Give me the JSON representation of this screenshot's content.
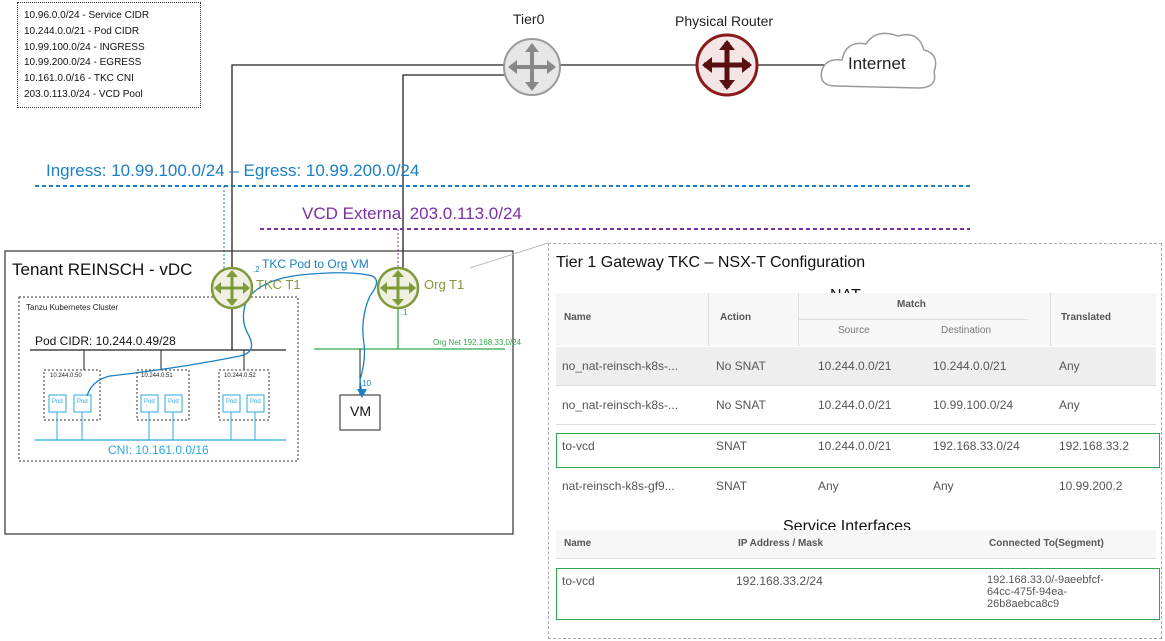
{
  "legend": [
    "10.96.0.0/24 - Service CIDR",
    "10.244.0.0/21 - Pod CIDR",
    "10.99.100.0/24 - INGRESS",
    "10.99.200.0/24 - EGRESS",
    "10.161.0.0/16 - TKC CNI",
    "203.0.113.0/24 - VCD Pool"
  ],
  "top": {
    "tier0": "Tier0",
    "physical_router": "Physical Router",
    "internet": "Internet"
  },
  "networks": {
    "ingress_egress": "Ingress: 10.99.100.0/24 – Egress: 10.99.200.0/24",
    "vcd_external": "VCD External 203.0.113.0/24"
  },
  "tenant": {
    "title": "Tenant REINSCH - vDC",
    "cluster_title": "Tanzu Kubernetes Cluster",
    "pod_cidr": "Pod CIDR: 10.244.0.49/28",
    "nodes": [
      "10.244.0.50",
      "10.244.0.51",
      "10.244.0.52"
    ],
    "pod_label": "Pod",
    "cni": "CNI: 10.161.0.0/16",
    "tkc_t1": "TKC T1",
    "org_t1": "Org T1",
    "flow_label": "TKC Pod to Org VM",
    "org_net": "Org Net 192.168.33.0/24",
    "vm": "VM",
    "tkc_port": ".2",
    "org_port": ".1",
    "vm_port": "10"
  },
  "panel": {
    "title": "Tier 1 Gateway TKC – NSX-T Configuration",
    "nat_title": "NAT",
    "headers": {
      "name": "Name",
      "action": "Action",
      "match": "Match",
      "source": "Source",
      "destination": "Destination",
      "translated": "Translated"
    },
    "nat_rows": [
      {
        "name": "no_nat-reinsch-k8s-...",
        "action": "No SNAT",
        "source": "10.244.0.0/21",
        "destination": "10.244.0.0/21",
        "translated": "Any"
      },
      {
        "name": "no_nat-reinsch-k8s-...",
        "action": "No SNAT",
        "source": "10.244.0.0/21",
        "destination": "10.99.100.0/24",
        "translated": "Any"
      },
      {
        "name": "to-vcd",
        "action": "SNAT",
        "source": "10.244.0.0/21",
        "destination": "192.168.33.0/24",
        "translated": "192.168.33.2"
      },
      {
        "name": "nat-reinsch-k8s-gf9...",
        "action": "SNAT",
        "source": "Any",
        "destination": "Any",
        "translated": "10.99.200.2"
      }
    ],
    "service_title": "Service Interfaces",
    "service_headers": {
      "name": "Name",
      "ip": "IP Address / Mask",
      "connected": "Connected To(Segment)"
    },
    "service_row": {
      "name": "to-vcd",
      "ip": "192.168.33.2/24",
      "connected": [
        "192.168.33.0/-9aeebfcf-",
        "64cc-475f-94ea-",
        "26b8aebca8c9"
      ]
    }
  },
  "colors": {
    "blue": "#1a7fc4",
    "purple": "#7b2fa6",
    "olive": "#7e9a3a",
    "green": "#2ea84a",
    "router_red": "#8b1a1a",
    "cyan": "#29a8dc"
  }
}
